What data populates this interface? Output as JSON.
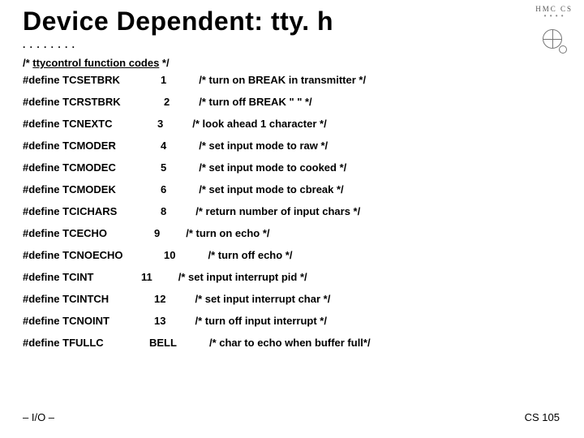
{
  "title": "Device Dependent:  tty. h",
  "dots": ". . . . . . . .",
  "subhead_prefix": "/* ",
  "subhead_main": "ttycontrol function codes",
  "subhead_suffix": " */",
  "defines": [
    {
      "name": "#define TCSETBRK",
      "val": "1",
      "cmt": "/* turn on BREAK in transmitter */",
      "valPad": 30,
      "cmtPad": 40
    },
    {
      "name": "#define TCRSTBRK",
      "val": "2",
      "cmt": "/* turn off BREAK \"        \"     */",
      "valPad": 34,
      "cmtPad": 36
    },
    {
      "name": "#define TCNEXTC",
      "val": "3",
      "cmt": "/* look ahead 1 character          */",
      "valPad": 26,
      "cmtPad": 36
    },
    {
      "name": "#define TCMODER",
      "val": "4",
      "cmt": "/* set input mode to raw          */",
      "valPad": 30,
      "cmtPad": 40
    },
    {
      "name": "#define TCMODEC",
      "val": "5",
      "cmt": "/* set input mode to cooked       */",
      "valPad": 30,
      "cmtPad": 40
    },
    {
      "name": "#define TCMODEK",
      "val": "6",
      "cmt": "/* set input mode to cbreak      */",
      "valPad": 30,
      "cmtPad": 40
    },
    {
      "name": "#define TCICHARS",
      "val": "8",
      "cmt": "/* return number of input chars */",
      "valPad": 30,
      "cmtPad": 36
    },
    {
      "name": "#define TCECHO",
      "val": "9",
      "cmt": "/* turn on echo                   */",
      "valPad": 22,
      "cmtPad": 32
    },
    {
      "name": "#define TCNOECHO",
      "val": "10",
      "cmt": "/* turn off echo                 */",
      "valPad": 34,
      "cmtPad": 40
    },
    {
      "name": "#define TCINT",
      "val": "11",
      "cmt": "/* set input interrupt pid     */",
      "valPad": 6,
      "cmtPad": 32
    },
    {
      "name": "#define TCINTCH",
      "val": "12",
      "cmt": "/* set input interrupt char     */",
      "valPad": 22,
      "cmtPad": 36
    },
    {
      "name": "#define TCNOINT",
      "val": "13",
      "cmt": "/* turn off input interrupt     */",
      "valPad": 22,
      "cmtPad": 36
    },
    {
      "name": "#define TFULLC",
      "val": "BELL",
      "cmt": "/* char to echo when buffer full*/",
      "valPad": 16,
      "cmtPad": 40
    }
  ],
  "footer_left": "– I/O –",
  "footer_right": "CS 105",
  "logo_text": "HMC CS"
}
